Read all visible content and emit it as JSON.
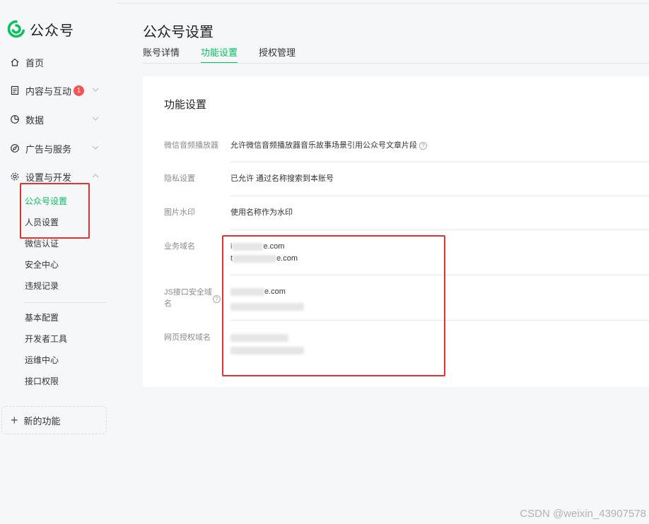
{
  "app": {
    "logo_text": "公众号"
  },
  "sidebar": {
    "items": [
      {
        "label": "首页"
      },
      {
        "label": "内容与互动",
        "badge": "1"
      },
      {
        "label": "数据"
      },
      {
        "label": "广告与服务"
      },
      {
        "label": "设置与开发"
      }
    ],
    "sub_items": [
      {
        "label": "公众号设置"
      },
      {
        "label": "人员设置"
      },
      {
        "label": "微信认证"
      },
      {
        "label": "安全中心"
      },
      {
        "label": "违规记录"
      },
      {
        "label": "基本配置"
      },
      {
        "label": "开发者工具"
      },
      {
        "label": "运维中心"
      },
      {
        "label": "接口权限"
      }
    ],
    "new_feature": "新的功能"
  },
  "header": {
    "title": "公众号设置",
    "tabs": [
      {
        "label": "账号详情"
      },
      {
        "label": "功能设置"
      },
      {
        "label": "授权管理"
      }
    ]
  },
  "card": {
    "title": "功能设置",
    "rows": [
      {
        "label": "微信音频播放器",
        "value": "允许微信音频播放器音乐故事场景引用公众号文章片段"
      },
      {
        "label": "隐私设置",
        "value": "已允许 通过名称搜索到本账号"
      },
      {
        "label": "图片水印",
        "value": "使用名称作为水印"
      },
      {
        "label": "业务域名",
        "line1_a": "i",
        "line1_b": "e.com",
        "line2_a": "t",
        "line2_b": "e.com"
      },
      {
        "label_1": "JS接口安全域",
        "label_2": "名",
        "line1_b": "e.com"
      },
      {
        "label": "网页授权域名"
      }
    ]
  },
  "watermark": "CSDN @weixin_43907578",
  "colors": {
    "accent": "#07c160",
    "badge": "#fa5151",
    "annotation": "#e63030"
  }
}
